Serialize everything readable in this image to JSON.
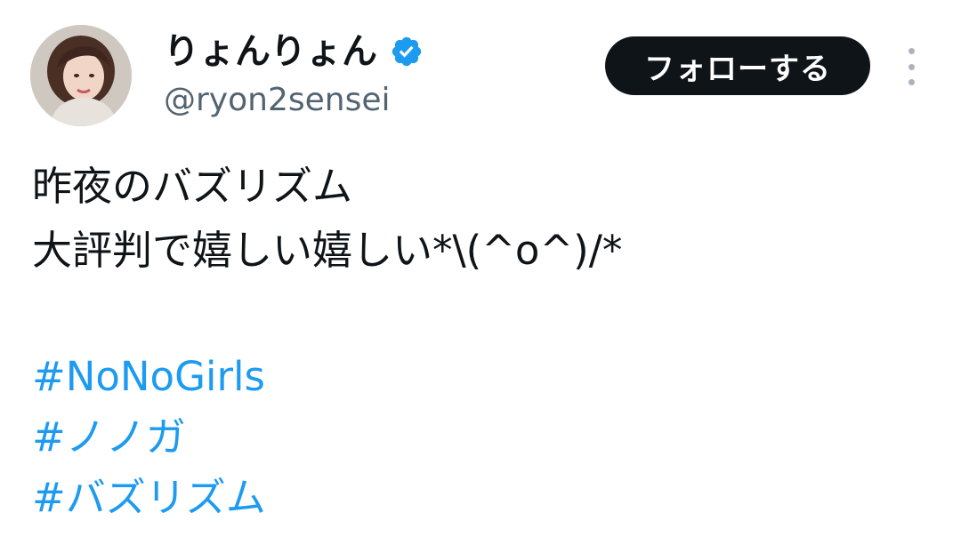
{
  "header": {
    "display_name": "りょんりょん",
    "handle": "@ryon2sensei",
    "verified_icon": "verified-badge-icon",
    "follow_label": "フォローする",
    "more_icon": "more-vertical-icon"
  },
  "tweet": {
    "lines": [
      "昨夜のバズリズム",
      "大評判で嬉しい嬉しい*\\(^o^)/*"
    ],
    "hashtags": [
      "#NoNoGirls",
      "#ノノガ",
      "#バズリズム"
    ]
  },
  "colors": {
    "text": "#0f1419",
    "secondary": "#536471",
    "link": "#1d9bf0",
    "verified": "#1d9bf0",
    "follow_bg": "#0f1419"
  }
}
